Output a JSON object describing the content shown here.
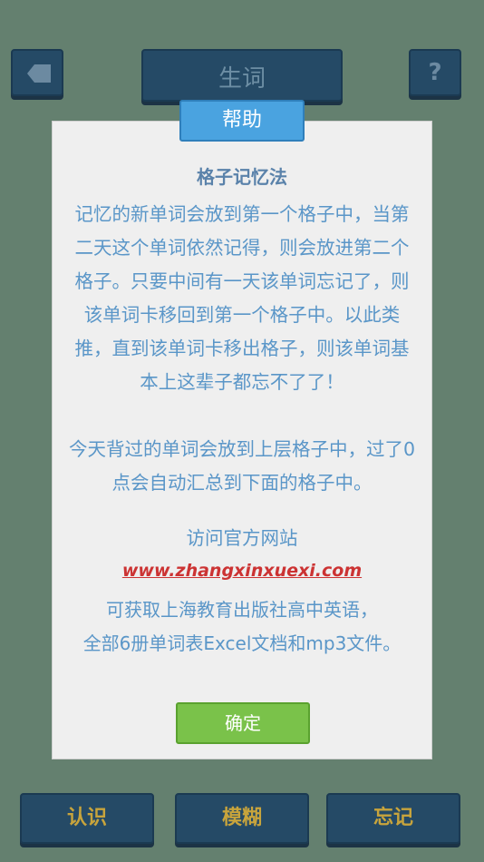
{
  "screen": {
    "title": "生词",
    "help_glyph": "?",
    "back_icon": "tag-back-icon",
    "bottom_buttons": [
      "认识",
      "模糊",
      "忘记"
    ]
  },
  "dialog": {
    "tab_label": "帮助",
    "heading": "格子记忆法",
    "paragraph1": "记忆的新单词会放到第一个格子中，当第二天这个单词依然记得，则会放进第二个格子。只要中间有一天该单词忘记了，则该单词卡移回到第一个格子中。以此类推，直到该单词卡移出格子，则该单词基本上这辈子都忘不了了！",
    "paragraph2": "今天背过的单词会放到上层格子中，过了0点会自动汇总到下面的格子中。",
    "visit_label": "访问官方网站",
    "website": "www.zhangxinxuexi.com",
    "paragraph3_line1": "可获取上海教育出版社高中英语，",
    "paragraph3_line2": "全部6册单词表Excel文档和mp3文件。",
    "ok_label": "确定"
  },
  "colors": {
    "background": "#64806f",
    "dark_button": "#254a66",
    "gold_text": "#c8a43c",
    "tab_blue": "#4aa3e0",
    "ok_green": "#7ac24a",
    "link_red": "#cc3333",
    "body_text_blue": "#5a96c8"
  }
}
